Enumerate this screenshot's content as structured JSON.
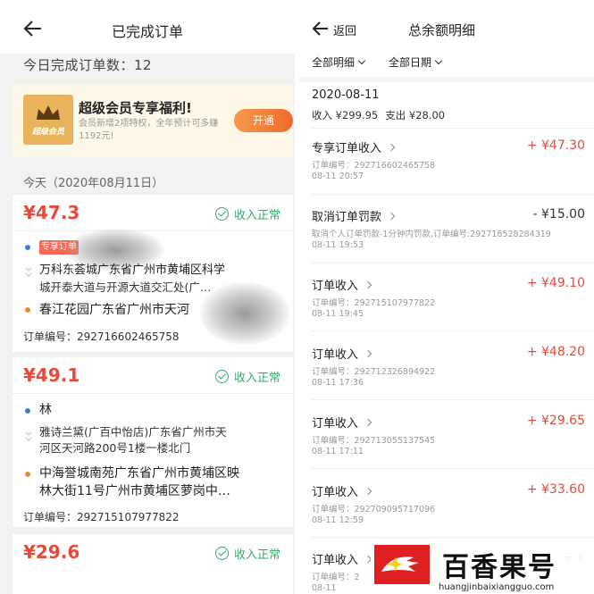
{
  "left": {
    "title": "已完成订单",
    "today_count": "今日完成订单数：12",
    "promo": {
      "title": "超级会员专享福利!",
      "desc": "会员新增2项特权，全年预计可多赚1192元!",
      "badge": "超级会员",
      "button": "开通"
    },
    "date_header": "今天（2020年08月11日）",
    "orders": [
      {
        "amount": "¥47.3",
        "status": "收入正常",
        "tag": "专享订单",
        "pickup": "万科东荟城广东省广州市黄埔区科学",
        "pickup_detail": "城开泰大道与开源大道交汇处(广…",
        "dropoff": "春江花园广东省广州市天河",
        "order_no": "订单编号：292716602465758"
      },
      {
        "amount": "¥49.1",
        "status": "收入正常",
        "pickup": "林",
        "pickup_detail_1": "雅诗兰黛(广百中怡店)广东省广州市天",
        "pickup_detail_2": "河区天河路200号1楼一楼北门",
        "dropoff_1": "中海誉城南苑广东省广州市黄埔区映",
        "dropoff_2": "林大街11号广州市黄埔区萝岗中…",
        "order_no": "订单编号：292715107977822"
      },
      {
        "amount": "¥29.6",
        "status": "收入正常"
      }
    ]
  },
  "right": {
    "back_label": "返回",
    "title": "总余额明细",
    "filters": [
      "全部明细",
      "全部日期"
    ],
    "date": "2020-08-11",
    "income": "收入 ¥299.95",
    "expense": "支出 ¥28.00",
    "entries": [
      {
        "title": "专享订单收入",
        "amount": "+ ¥47.30",
        "line1": "订单编号：292716602465758",
        "line2": "08-11 20:57",
        "sign": "pos"
      },
      {
        "title": "取消订单罚款",
        "amount": "- ¥15.00",
        "line1": "取消个人订单罚款-1分钟内罚款,订单编号:292716528284319",
        "line2": "08-11 19:53",
        "sign": "neg"
      },
      {
        "title": "订单收入",
        "amount": "+ ¥49.10",
        "line1": "订单编号：292715107977822",
        "line2": "08-11 19:45",
        "sign": "pos"
      },
      {
        "title": "订单收入",
        "amount": "+ ¥48.20",
        "line1": "订单编号：292712326894922",
        "line2": "08-11 17:36",
        "sign": "pos"
      },
      {
        "title": "订单收入",
        "amount": "+ ¥29.65",
        "line1": "订单编号：292713055137545",
        "line2": "08-11 17:11",
        "sign": "pos"
      },
      {
        "title": "订单收入",
        "amount": "+ ¥33.60",
        "line1": "订单编号：292709095717096",
        "line2": "08-11 12:59",
        "sign": "pos"
      },
      {
        "title": "订单收入",
        "amount": "+ ¥",
        "line1": "订单编号：2",
        "line2": "08-11 ",
        "sign": "pos"
      }
    ]
  },
  "watermark": {
    "brand": "百香果号",
    "url": "huangjinbaixiangguo.com"
  },
  "colors": {
    "accent_red": "#e84a3a",
    "status_green": "#38a86a",
    "promo_orange": "#ee6a2d"
  }
}
